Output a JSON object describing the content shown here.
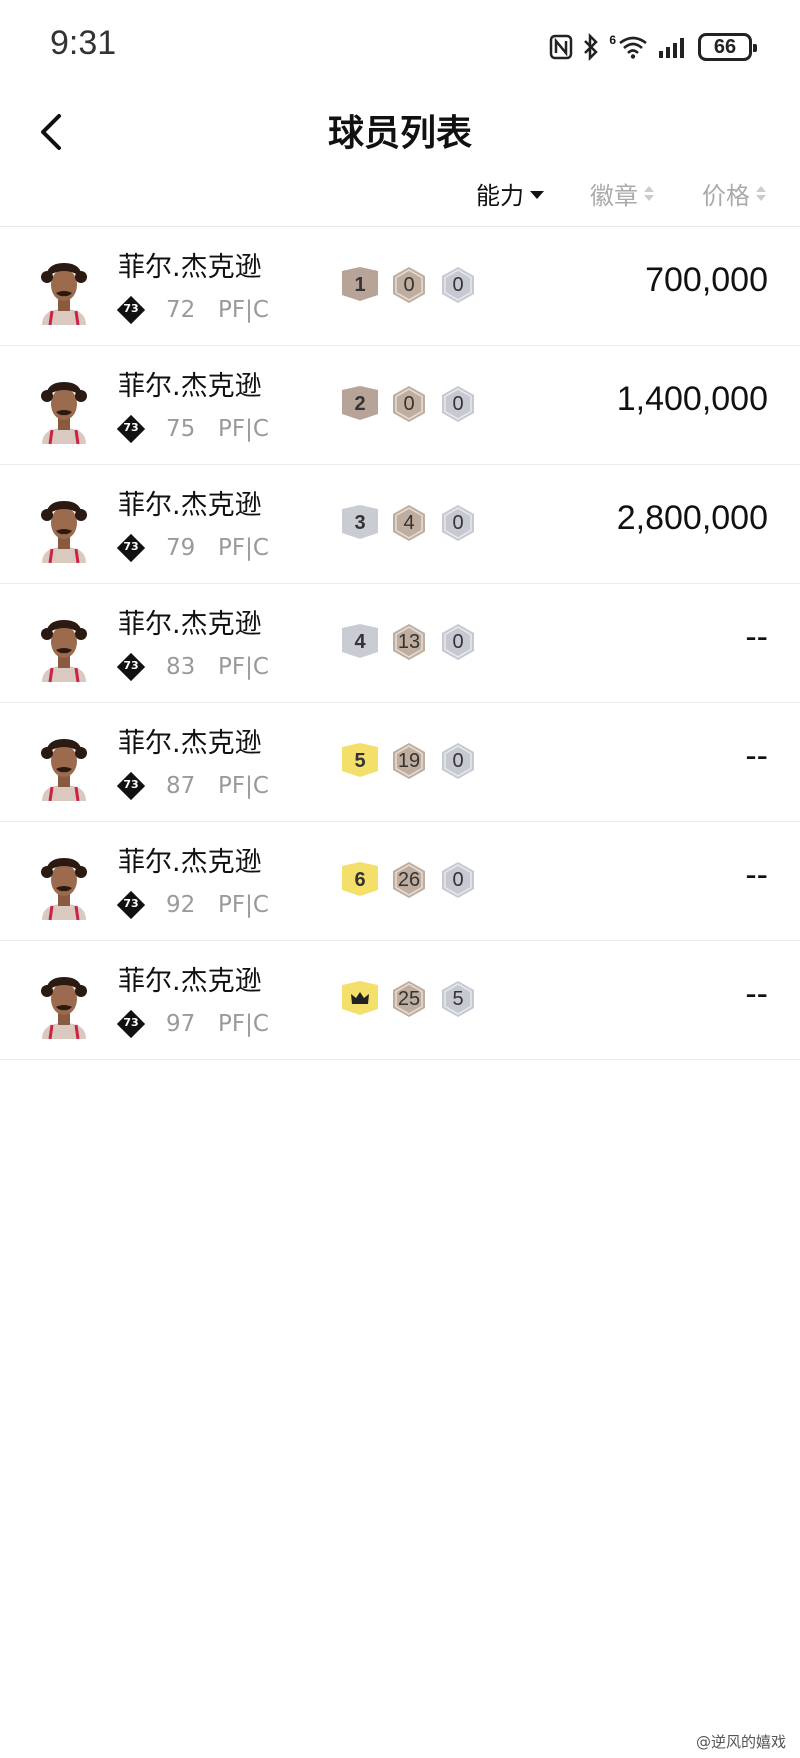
{
  "status_bar": {
    "time": "9:31",
    "battery": "66",
    "network_label": "6",
    "icons": [
      "nfc-icon",
      "bluetooth-icon",
      "wifi-icon",
      "signal-icon",
      "battery-icon"
    ]
  },
  "header": {
    "title": "球员列表",
    "back_icon": "chevron-left-icon"
  },
  "sort": {
    "ability": "能力",
    "badge": "徽章",
    "price": "价格",
    "active": "ability"
  },
  "players": [
    {
      "name": "菲尔.杰克逊",
      "card_rating": "73",
      "ovr": "72",
      "position": "PF|C",
      "level": "1",
      "level_style": "bronze",
      "badge_a": "0",
      "badge_b": "0",
      "price": "700,000"
    },
    {
      "name": "菲尔.杰克逊",
      "card_rating": "73",
      "ovr": "75",
      "position": "PF|C",
      "level": "2",
      "level_style": "bronze",
      "badge_a": "0",
      "badge_b": "0",
      "price": "1,400,000"
    },
    {
      "name": "菲尔.杰克逊",
      "card_rating": "73",
      "ovr": "79",
      "position": "PF|C",
      "level": "3",
      "level_style": "silver",
      "badge_a": "4",
      "badge_b": "0",
      "price": "2,800,000"
    },
    {
      "name": "菲尔.杰克逊",
      "card_rating": "73",
      "ovr": "83",
      "position": "PF|C",
      "level": "4",
      "level_style": "silver",
      "badge_a": "13",
      "badge_b": "0",
      "price": "--"
    },
    {
      "name": "菲尔.杰克逊",
      "card_rating": "73",
      "ovr": "87",
      "position": "PF|C",
      "level": "5",
      "level_style": "gold",
      "badge_a": "19",
      "badge_b": "0",
      "price": "--"
    },
    {
      "name": "菲尔.杰克逊",
      "card_rating": "73",
      "ovr": "92",
      "position": "PF|C",
      "level": "6",
      "level_style": "gold",
      "badge_a": "26",
      "badge_b": "0",
      "price": "--"
    },
    {
      "name": "菲尔.杰克逊",
      "card_rating": "73",
      "ovr": "97",
      "position": "PF|C",
      "level": "",
      "level_style": "crown",
      "badge_a": "25",
      "badge_b": "5",
      "price": "--"
    }
  ],
  "colors": {
    "bronze": "#b7a397",
    "silver": "#c9ccd3",
    "gold": "#f3df6a",
    "badge_bronze": "#bfae9f",
    "badge_silver": "#c6c9d2"
  },
  "watermark": "@逆风的嬉戏"
}
